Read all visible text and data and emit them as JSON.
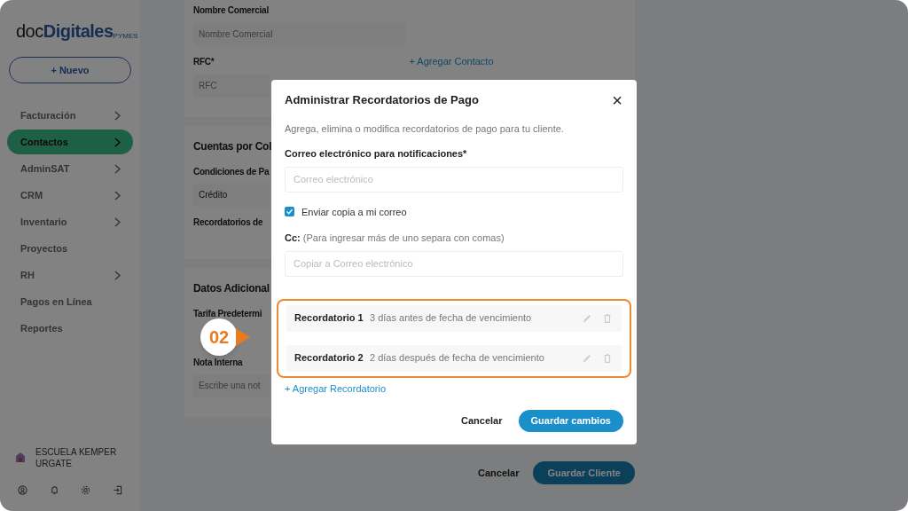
{
  "sidebar": {
    "logo": {
      "prefix": "doc",
      "brand": "Digitales",
      "suffix": "PYMES"
    },
    "new_button": "+ Nuevo",
    "items": [
      {
        "label": "Facturación",
        "selected": false,
        "expandable": true
      },
      {
        "label": "Contactos",
        "selected": true,
        "expandable": true
      },
      {
        "label": "AdminSAT",
        "selected": false,
        "expandable": true
      },
      {
        "label": "CRM",
        "selected": false,
        "expandable": true
      },
      {
        "label": "Inventario",
        "selected": false,
        "expandable": true
      },
      {
        "label": "Proyectos",
        "selected": false,
        "expandable": false
      },
      {
        "label": "RH",
        "selected": false,
        "expandable": true
      },
      {
        "label": "Pagos en Línea",
        "selected": false,
        "expandable": false
      },
      {
        "label": "Reportes",
        "selected": false,
        "expandable": false
      }
    ],
    "user": {
      "name": "ESCUELA KEMPER URGATE"
    }
  },
  "form": {
    "sections": [
      {
        "fields": [
          {
            "label": "Nombre Comercial",
            "placeholder": "Nombre Comercial"
          },
          {
            "label": "RFC*",
            "placeholder": "RFC",
            "link": "+ Agregar Contacto"
          }
        ]
      },
      {
        "title": "Cuentas por Col",
        "fields": [
          {
            "label": "Condiciones de Pa",
            "value": "Crédito"
          },
          {
            "label": "Recordatorios de"
          }
        ]
      },
      {
        "title": "Datos Adicional",
        "fields": [
          {
            "label": "Tarifa Predetermi"
          },
          {
            "label": "Nota Interna",
            "placeholder": "Escribe una not"
          }
        ]
      }
    ],
    "cancel": "Cancelar",
    "save": "Guardar Cliente"
  },
  "modal": {
    "title": "Administrar Recordatorios de Pago",
    "close": "×",
    "description": "Agrega, elimina o modifica recordatorios de pago para tu cliente.",
    "email_label": "Correo electrónico para notificaciones*",
    "email_placeholder": "Correo electrónico",
    "copy_checkbox": {
      "label": "Enviar copia a mi correo",
      "checked": true
    },
    "cc_label": "**Cc:** (Para ingresar más de uno separa con comas)",
    "cc_placeholder": "Copiar a Correo electrónico",
    "reminders": [
      {
        "name": "Recordatorio 1",
        "description": "3 días antes de fecha de vencimiento"
      },
      {
        "name": "Recordatorio 2",
        "description": "2 días después de fecha de vencimiento"
      }
    ],
    "add_link": "+ Agregar Recordatorio",
    "cancel": "Cancelar",
    "save": "Guardar cambios"
  },
  "callout": {
    "label": "02"
  }
}
